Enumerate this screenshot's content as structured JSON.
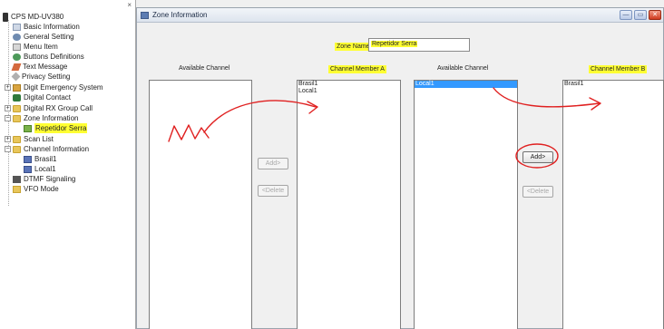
{
  "tree": {
    "root": "CPS MD-UV380",
    "close_symbol": "×",
    "items": [
      {
        "label": "Basic Information",
        "icon": "doc-icon"
      },
      {
        "label": "General Setting",
        "icon": "gear-icon"
      },
      {
        "label": "Menu Item",
        "icon": "menu-icon"
      },
      {
        "label": "Buttons Definitions",
        "icon": "buttons-icon"
      },
      {
        "label": "Text Message",
        "icon": "message-icon"
      },
      {
        "label": "Privacy Setting",
        "icon": "key-icon"
      },
      {
        "label": "Digit Emergency System",
        "icon": "folder-icon"
      },
      {
        "label": "Digital Contact",
        "icon": "contact-icon"
      },
      {
        "label": "Digital RX Group Call",
        "icon": "folder-icon"
      },
      {
        "label": "Zone Information",
        "icon": "folder-icon"
      },
      {
        "label": "Repetidor Serra",
        "icon": "zone-icon"
      },
      {
        "label": "Scan List",
        "icon": "folder-icon"
      },
      {
        "label": "Channel Information",
        "icon": "folder-icon"
      },
      {
        "label": "Brasil1",
        "icon": "channel-icon"
      },
      {
        "label": "Local1",
        "icon": "channel-icon"
      },
      {
        "label": "DTMF Signaling",
        "icon": "dtmf-icon"
      },
      {
        "label": "VFO Mode",
        "icon": "folder-icon"
      }
    ],
    "expanders": {
      "collapsed": "+",
      "expanded": "−"
    }
  },
  "window": {
    "title": "Zone Information",
    "buttons": {
      "minimize": "—",
      "maximize": "▭",
      "close": "✕"
    }
  },
  "zone": {
    "name_label": "Zone Name",
    "name_value": "Repetidor Serra"
  },
  "columns": {
    "available_a": "Available Channel",
    "member_a": "Channel Member A",
    "available_b": "Available Channel",
    "member_b": "Channel Member B"
  },
  "lists": {
    "available_a": [],
    "member_a": [
      "Brasil1",
      "Local1"
    ],
    "available_b": [
      "Local1"
    ],
    "member_b": [
      "Brasil1"
    ]
  },
  "buttons": {
    "add_a": "Add>",
    "delete_a": "<Delete",
    "add_b": "Add>",
    "delete_b": "<Delete"
  },
  "colors": {
    "highlight": "#ffff33",
    "selection": "#3399ff",
    "annotation": "#e02020"
  }
}
